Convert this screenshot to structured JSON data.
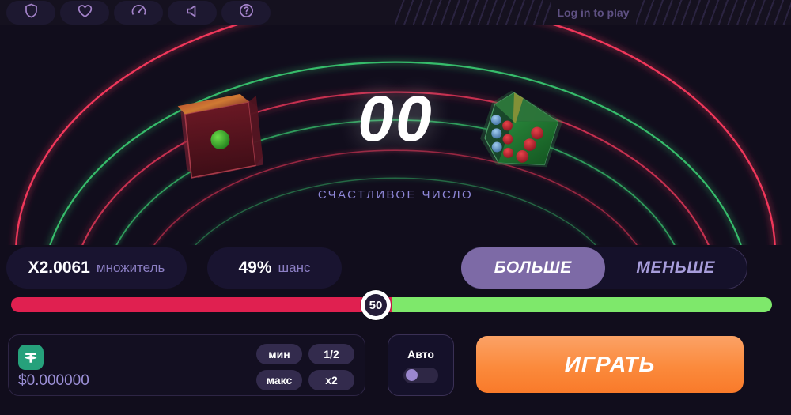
{
  "header": {
    "icons": [
      {
        "name": "shield-icon",
        "label": "Provably fair"
      },
      {
        "name": "heart-icon",
        "label": "Favorites"
      },
      {
        "name": "gauge-icon",
        "label": "Statistics"
      },
      {
        "name": "speaker-icon",
        "label": "Sound"
      },
      {
        "name": "help-icon",
        "label": "Help"
      }
    ],
    "login_text": "Log in to play"
  },
  "game": {
    "lucky_number": "00",
    "lucky_label": "СЧАСТЛИВОЕ ЧИСЛО",
    "dice": [
      {
        "name": "die-red",
        "color": "#5c1420",
        "pips": 1
      },
      {
        "name": "die-green",
        "color": "#1c6b2a",
        "pips": 3
      }
    ]
  },
  "stats": {
    "multiplier_value": "X2.0061",
    "multiplier_label": "множитель",
    "chance_value": "49%",
    "chance_label": "шанс"
  },
  "direction": {
    "higher_label": "БОЛЬШЕ",
    "lower_label": "МЕНЬШЕ",
    "selected": "higher"
  },
  "slider": {
    "value": "50",
    "min": 0,
    "max": 100,
    "left_color": "#e02050",
    "right_color": "#7ee86b"
  },
  "bet": {
    "currency_icon": "tether-icon",
    "amount": "$0.000000",
    "quick_buttons": [
      {
        "name": "bet-min-button",
        "label": "мин"
      },
      {
        "name": "bet-half-button",
        "label": "1/2"
      },
      {
        "name": "bet-max-button",
        "label": "макс"
      },
      {
        "name": "bet-x2-button",
        "label": "x2"
      }
    ]
  },
  "auto": {
    "label": "Авто",
    "enabled": false
  },
  "play": {
    "label": "ИГРАТЬ"
  },
  "colors": {
    "background": "#110d1c",
    "accent_purple": "#7d6aa6",
    "accent_orange": "#fb8a3c",
    "danger_red": "#e02050",
    "success_green": "#7ee86b"
  }
}
